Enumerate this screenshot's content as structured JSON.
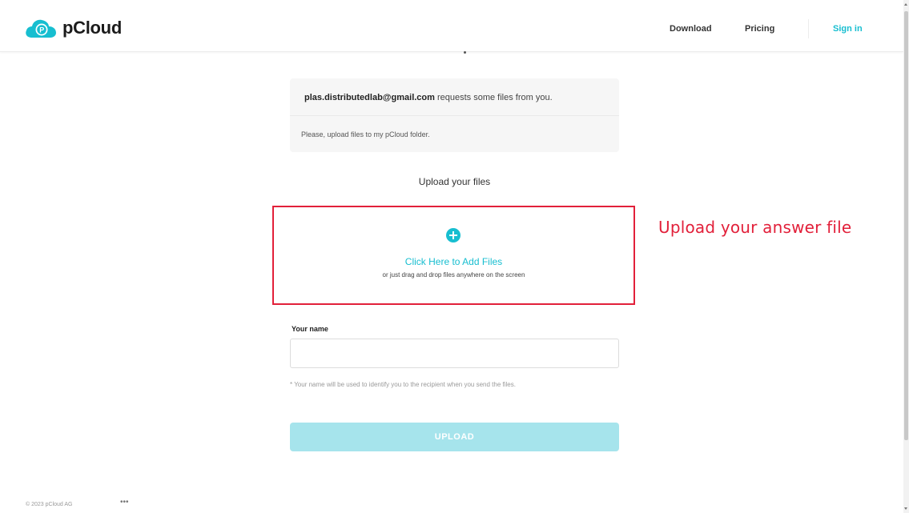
{
  "brand": {
    "name": "pCloud",
    "accent_color": "#17bed0"
  },
  "nav": {
    "download": "Download",
    "pricing": "Pricing",
    "signin": "Sign in"
  },
  "request": {
    "email": "plas.distributedlab@gmail.com",
    "text": " requests some files from you.",
    "message": "Please, upload files to my pCloud folder."
  },
  "upload": {
    "title": "Upload your files",
    "add_files": "Click Here to Add Files",
    "drag_hint": "or just drag and drop files anywhere on the screen",
    "highlight_color": "#e2203a"
  },
  "annotation": {
    "text": "Upload your answer file"
  },
  "form": {
    "name_label": "Your name",
    "name_value": "",
    "name_hint": "* Your name will be used to identify you to the recipient when you send the files.",
    "upload_button": "UPLOAD"
  },
  "footer": {
    "copyright": "© 2023 pCloud AG",
    "more": "•••"
  }
}
